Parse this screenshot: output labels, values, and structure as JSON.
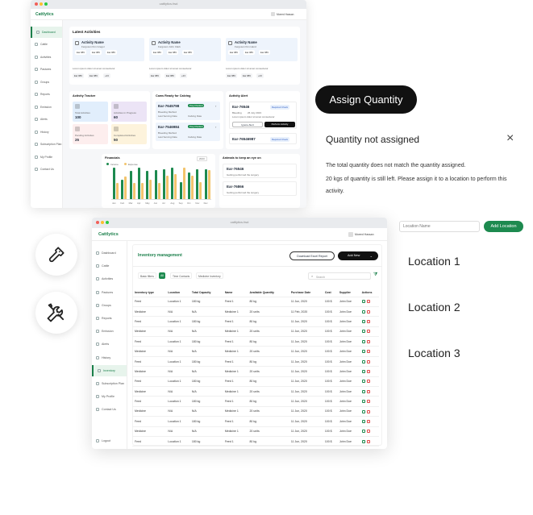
{
  "top_window": {
    "url": "cattlytics.fwd",
    "brand": "Cattlytics",
    "user": "Moeed Hassan",
    "sidebar": [
      "Dashboard",
      "Cattle",
      "Activities",
      "Pastures",
      "Groups",
      "Reports",
      "Emission",
      "Alerts",
      "History",
      "Subscription Plan",
      "My Profile",
      "Contact Us"
    ],
    "latest_activities": {
      "title": "Latest Activities",
      "cards": [
        {
          "name": "Activity Name",
          "sub": "Ferguson Kim Gregor",
          "tags": [
            "Ear #89",
            "Ear #89",
            "Ear #89"
          ],
          "note": "Lorem ipsum dolor sit amet consectetur",
          "tags2": [
            "Ear #89",
            "Ear #89",
            "+23"
          ]
        },
        {
          "name": "Activity Name",
          "sub": "Ferguson John Clark",
          "tags": [
            "Ear #89",
            "Ear #89",
            "Ear #89"
          ],
          "note": "Lorem ipsum dolor sit amet consectetur",
          "tags2": [
            "Ear #89",
            "Ear #89",
            "+23"
          ]
        },
        {
          "name": "Activity Name",
          "sub": "Ferguson Kim Hand",
          "tags": [
            "Ear #89",
            "Ear #89",
            "Ear #89"
          ],
          "note": "Lorem ipsum dolor sit amet consectetur",
          "tags2": [
            "Ear #89",
            "Ear #89",
            "+23"
          ]
        }
      ]
    },
    "activity_tracker": {
      "title": "Activity Tracker",
      "tiles": [
        {
          "label": "Total Activities",
          "value": "100",
          "color": "#e1eefc"
        },
        {
          "label": "Activities in Progress",
          "value": "60",
          "color": "#ece4f6"
        },
        {
          "label": "Pending Activities",
          "value": "25",
          "color": "#fdeeee"
        },
        {
          "label": "Completed Activities",
          "value": "50",
          "color": "#fdf3dc"
        }
      ]
    },
    "cows_ready": {
      "title": "Cows Ready for Calving",
      "items": [
        {
          "ear": "Ear-7645798",
          "badge": "Preg Checked",
          "l1": "Breeding Method",
          "l2": "Last Serving Date",
          "l3": "Calving Date"
        },
        {
          "ear": "Ear-7546984",
          "badge": "Preg Checked",
          "l1": "Breeding Method",
          "l2": "Last Serving Date",
          "l3": "Calving Date"
        }
      ]
    },
    "activity_alert": {
      "title": "Activity Alert",
      "items": [
        {
          "ear": "Ear-76546",
          "badge": "Required Check",
          "status": "Bleeding",
          "date": "26 July 2023",
          "desc": "Lorem ipsum dolor sit amet consectetur"
        },
        {
          "ear": "Ear-76546987",
          "badge": "Required Check",
          "status": "",
          "date": "",
          "desc": ""
        }
      ],
      "ignore_label": "Ignore Alert",
      "perform_label": "Perform Activity"
    },
    "financials": {
      "title": "Financials",
      "legend": [
        "Income",
        "Expense"
      ],
      "period": "2023"
    },
    "animals_eye": {
      "title": "Animals to keep an eye on",
      "items": [
        {
          "ear": "Ear-76546",
          "note": "Getting performed the surgery"
        },
        {
          "ear": "Ear-76866",
          "note": "Getting performed the surgery"
        }
      ]
    }
  },
  "chart_data": {
    "type": "bar",
    "series": [
      {
        "name": "Income",
        "color": "#1d8a4f",
        "values": [
          58,
          36,
          52,
          58,
          52,
          54,
          56,
          58,
          32,
          50,
          56,
          56
        ]
      },
      {
        "name": "Expense",
        "color": "#f2c46d",
        "values": [
          30,
          42,
          30,
          30,
          36,
          30,
          44,
          46,
          58,
          44,
          32,
          54
        ]
      }
    ],
    "categories": [
      "Jan",
      "Feb",
      "Mar",
      "Apr",
      "May",
      "Jun",
      "Jul",
      "Aug",
      "Sep",
      "Oct",
      "Nov",
      "Dec"
    ],
    "ylim": [
      0,
      60
    ]
  },
  "assign_pill": "Assign Quantity",
  "dialog": {
    "title": "Quantity not assigned",
    "close": "×",
    "line1": "The total quantity does not match the quantity assigned.",
    "line2": "20 kgs of quantity is still left. Please assign it to a location to perform this activity."
  },
  "location_input": {
    "placeholder": "Location Name"
  },
  "add_location_label": "Add Location",
  "locations": [
    "Location 1",
    "Location 2",
    "Location 3"
  ],
  "bottom_window": {
    "url": "cattlytics.fwd",
    "brand": "Cattlytics",
    "user": "Moeed Hassan",
    "sidebar": [
      "Dashboard",
      "Cattle",
      "Activities",
      "Pastures",
      "Groups",
      "Reports",
      "Emission",
      "Alerts",
      "History",
      "Inventory",
      "Subscription Plan",
      "My Profile",
      "Contact Us"
    ],
    "logout": "Logout",
    "title": "Inventory management",
    "download_label": "Download Excel Report",
    "add_new_label": "Add New",
    "filters": [
      "Basic filters",
      "All",
      "Time Contacts",
      "Medicine Inventory"
    ],
    "search_placeholder": "Search",
    "columns": [
      "Inventory type",
      "Location",
      "Total Capacity",
      "Name",
      "Available Quantity",
      "Purchase Date",
      "Cost",
      "Supplier",
      "Actions"
    ],
    "rows": [
      [
        "Feed",
        "Location 1",
        "180 kg",
        "Feed 1",
        "80 kg",
        "11 Jun, 2020",
        "100 $",
        "John Doe"
      ],
      [
        "Medicine",
        "N/A",
        "N/A",
        "Medicine 1",
        "20 units",
        "11 Feb, 2020",
        "100 $",
        "John Doe"
      ],
      [
        "Feed",
        "Location 1",
        "180 kg",
        "Feed 1",
        "80 kg",
        "11 Jun, 2020",
        "100 $",
        "John Doe"
      ],
      [
        "Medicine",
        "N/A",
        "N/A",
        "Medicine 1",
        "20 units",
        "11 Jun, 2020",
        "100 $",
        "John Doe"
      ],
      [
        "Feed",
        "Location 1",
        "180 kg",
        "Feed 1",
        "80 kg",
        "11 Jun, 2020",
        "100 $",
        "John Doe"
      ],
      [
        "Medicine",
        "N/A",
        "N/A",
        "Medicine 1",
        "20 units",
        "11 Jun, 2020",
        "100 $",
        "John Doe"
      ],
      [
        "Feed",
        "Location 1",
        "180 kg",
        "Feed 1",
        "80 kg",
        "11 Jun, 2020",
        "100 $",
        "John Doe"
      ],
      [
        "Medicine",
        "N/A",
        "N/A",
        "Medicine 1",
        "20 units",
        "11 Jun, 2020",
        "100 $",
        "John Doe"
      ],
      [
        "Feed",
        "Location 1",
        "180 kg",
        "Feed 1",
        "80 kg",
        "11 Jun, 2020",
        "100 $",
        "John Doe"
      ],
      [
        "Medicine",
        "N/A",
        "N/A",
        "Medicine 1",
        "20 units",
        "11 Jun, 2020",
        "100 $",
        "John Doe"
      ],
      [
        "Feed",
        "Location 1",
        "180 kg",
        "Feed 1",
        "80 kg",
        "11 Jun, 2020",
        "100 $",
        "John Doe"
      ],
      [
        "Medicine",
        "N/A",
        "N/A",
        "Medicine 1",
        "20 units",
        "11 Jun, 2020",
        "100 $",
        "John Doe"
      ],
      [
        "Feed",
        "Location 1",
        "180 kg",
        "Feed 1",
        "80 kg",
        "11 Jun, 2020",
        "100 $",
        "John Doe"
      ],
      [
        "Medicine",
        "N/A",
        "N/A",
        "Medicine 1",
        "20 units",
        "11 Jun, 2020",
        "100 $",
        "John Doe"
      ],
      [
        "Feed",
        "Location 1",
        "180 kg",
        "Feed 1",
        "80 kg",
        "11 Jun, 2020",
        "100 $",
        "John Doe"
      ],
      [
        "Feed",
        "Location 1",
        "180 kg",
        "Feed 1",
        "80 kg",
        "11 Jun, 2020",
        "100 $",
        "John Doe"
      ]
    ]
  },
  "icons": {
    "left_1": "flashlight-icon",
    "left_2": "tools-icon"
  },
  "colors": {
    "brand": "#1a7f4a",
    "accent_green": "#1d8a4f",
    "dark": "#111111"
  }
}
